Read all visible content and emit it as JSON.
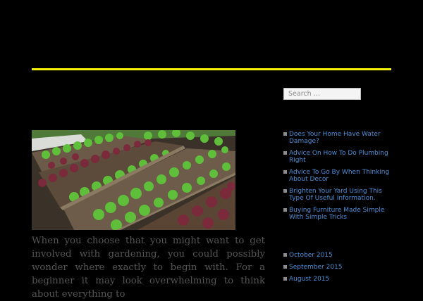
{
  "search": {
    "placeholder": "Search …"
  },
  "featured_image": {
    "alt": ""
  },
  "post": {
    "excerpt": "When you choose that you might want to get involved with gardening, you could possibly wonder where exactly to begin with. For a beginner it may look overwhelming to think about everything to"
  },
  "recent_posts": [
    {
      "label": "Does Your Home Have Water Damage?"
    },
    {
      "label": "Advice On How To Do Plumbing Right"
    },
    {
      "label": "Advice To Go By When Thinking About Decor"
    },
    {
      "label": "Brighten Your Yard Using This Type Of Useful Information."
    },
    {
      "label": "Buying Furniture Made Simple With Simple Tricks"
    }
  ],
  "archives": [
    {
      "label": "October 2015"
    },
    {
      "label": "September 2015"
    },
    {
      "label": "August 2015"
    }
  ],
  "colors": {
    "background": "#000000",
    "accent_rule": "#f2f20a",
    "link": "#4a90d9",
    "excerpt_text": "#555555"
  }
}
